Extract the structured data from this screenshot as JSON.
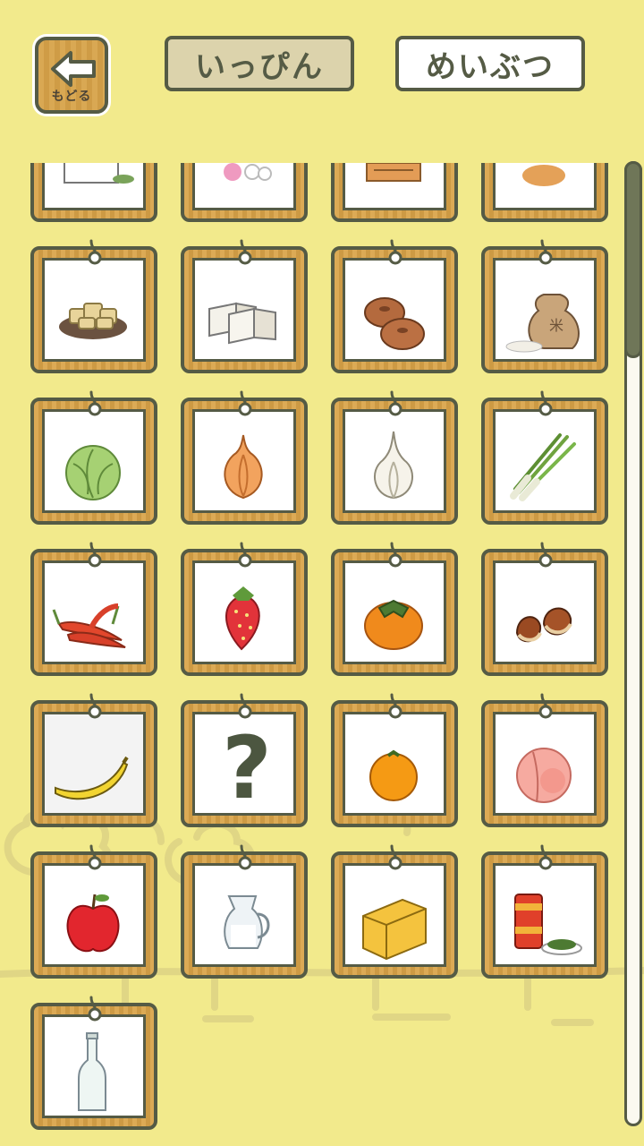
{
  "header": {
    "back_label": "もどる",
    "tabs": [
      {
        "label": "いっぴん",
        "active": true
      },
      {
        "label": "めいぶつ",
        "active": false
      }
    ]
  },
  "items": [
    {
      "icon": "tofu-block-icon"
    },
    {
      "icon": "flower-candy-icon"
    },
    {
      "icon": "rice-cracker-icon"
    },
    {
      "icon": "bun-icon"
    },
    {
      "icon": "fried-tofu-plate-icon"
    },
    {
      "icon": "tofu-icon"
    },
    {
      "icon": "manju-buns-icon"
    },
    {
      "icon": "rice-sack-icon"
    },
    {
      "icon": "cabbage-icon"
    },
    {
      "icon": "onion-icon"
    },
    {
      "icon": "garlic-icon"
    },
    {
      "icon": "green-onion-icon"
    },
    {
      "icon": "chili-pepper-icon"
    },
    {
      "icon": "strawberry-icon"
    },
    {
      "icon": "persimmon-icon"
    },
    {
      "icon": "chestnut-icon"
    },
    {
      "icon": "banana-icon",
      "seen": true
    },
    {
      "icon": "question-mark-icon",
      "text": "?"
    },
    {
      "icon": "mandarin-orange-icon"
    },
    {
      "icon": "peach-icon"
    },
    {
      "icon": "apple-icon"
    },
    {
      "icon": "milk-pitcher-icon"
    },
    {
      "icon": "cheese-icon"
    },
    {
      "icon": "tea-can-icon"
    },
    {
      "icon": "glass-bottle-icon"
    }
  ],
  "colors": {
    "background": "#f2ea8c",
    "outline": "#555b45",
    "wood": "#dcaa55",
    "tab_active": "#dcd3ac"
  },
  "scroll": {
    "position_fraction": 0.0
  }
}
